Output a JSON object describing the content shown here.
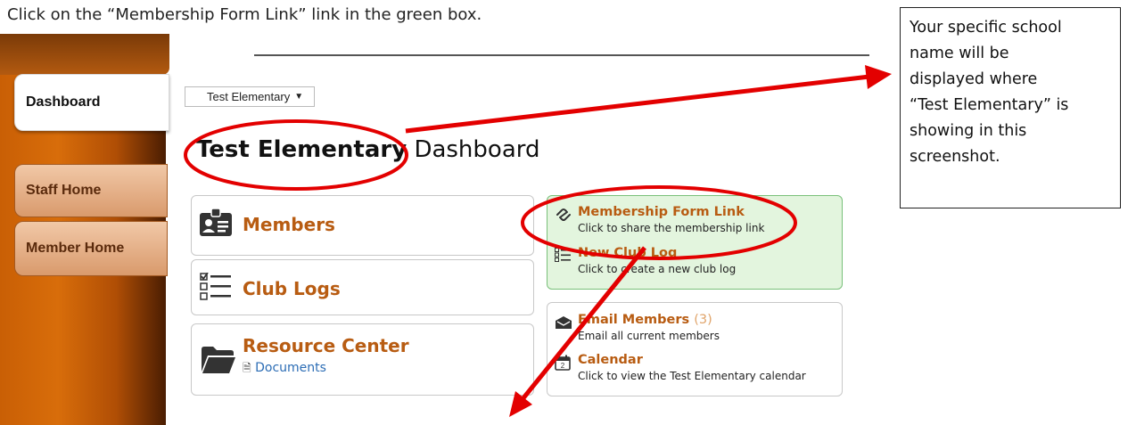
{
  "instruction": "Click on the “Membership Form Link” link in the green box.",
  "note": {
    "lines": [
      "Your specific school",
      "name will be",
      "displayed where",
      "“Test Elementary” is",
      "showing in this",
      "screenshot."
    ]
  },
  "sidebar": {
    "tabs": [
      "Dashboard",
      "Staff Home",
      "Member Home"
    ]
  },
  "school_select": {
    "value": "Test Elementary"
  },
  "heading": {
    "school": "Test Elementary",
    "suffix": "Dashboard"
  },
  "cards": {
    "members": {
      "title": "Members"
    },
    "club_logs": {
      "title": "Club Logs"
    },
    "resource_center": {
      "title": "Resource Center",
      "link": "Documents"
    },
    "membership_link": {
      "title": "Membership Form Link",
      "sub": "Click to share the membership link"
    },
    "new_club_log": {
      "title": "New Club Log",
      "sub": "Click to create a new club log"
    },
    "email_members": {
      "title": "Email Members",
      "count": "(3)",
      "sub": "Email all current members"
    },
    "calendar": {
      "title": "Calendar",
      "sub": "Click to view the Test Elementary calendar"
    }
  },
  "colors": {
    "accent": "#b85c12",
    "annotation": "#e30000",
    "green_box": "#e3f5de"
  }
}
